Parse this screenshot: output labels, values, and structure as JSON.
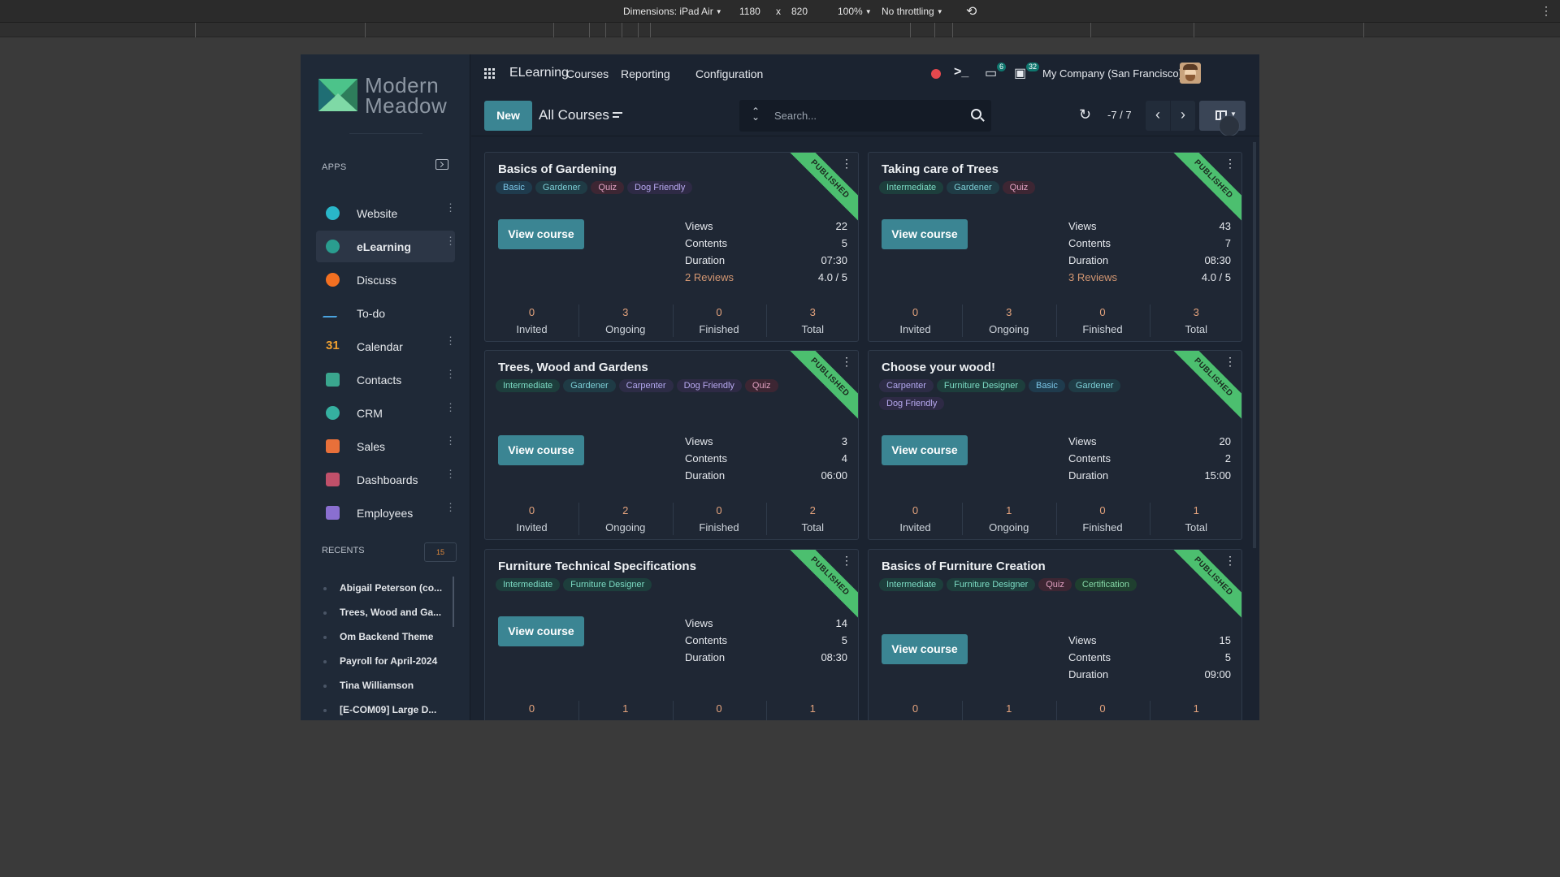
{
  "devtools": {
    "dimensions_label": "Dimensions: iPad Air",
    "width": "1180",
    "times": "x",
    "height": "820",
    "zoom": "100%",
    "throttling": "No throttling",
    "rotate_icon": "rotate-icon",
    "more_icon": "more-vertical-icon"
  },
  "sidebar": {
    "logo_line1": "Modern",
    "logo_line2": "Meadow",
    "apps_heading": "APPS",
    "apps": [
      {
        "label": "Website",
        "color": "#29b6c9",
        "menu": true
      },
      {
        "label": "eLearning",
        "color": "#2a9d8f",
        "menu": true,
        "active": true
      },
      {
        "label": "Discuss",
        "color": "#f37021",
        "menu": false
      },
      {
        "label": "To-do",
        "color": "#4aa3df",
        "menu": false
      },
      {
        "label": "Calendar",
        "color": "#f0a030",
        "menu": true
      },
      {
        "label": "Contacts",
        "color": "#3aa68e",
        "menu": true
      },
      {
        "label": "CRM",
        "color": "#35b0a0",
        "menu": true
      },
      {
        "label": "Sales",
        "color": "#e8703a",
        "menu": true
      },
      {
        "label": "Dashboards",
        "color": "#c0506a",
        "menu": true
      },
      {
        "label": "Employees",
        "color": "#8a6fd0",
        "menu": true
      }
    ],
    "calendar_glyph": "31",
    "recents_heading": "RECENTS",
    "recents_count": "15",
    "recents": [
      "Abigail Peterson (co...",
      "Trees, Wood and Ga...",
      "Om Backend Theme",
      "Payroll for April-2024",
      "Tina Williamson",
      "[E-COM09] Large D..."
    ]
  },
  "topnav": {
    "brand": "ELearning",
    "links": [
      "Courses",
      "Reporting",
      "Configuration"
    ],
    "messages_badge": "6",
    "activities_badge": "32",
    "company": "My Company (San Francisco)"
  },
  "control": {
    "new_label": "New",
    "breadcrumb": "All Courses",
    "search_placeholder": "Search...",
    "pager": "-7 / 7"
  },
  "tag_colors": {
    "Basic": {
      "bg": "#1f3b4d",
      "fg": "#7cc7e8"
    },
    "Gardener": {
      "bg": "#1f3b45",
      "fg": "#7ccfd6"
    },
    "Quiz": {
      "bg": "#3d2633",
      "fg": "#e0a0c0"
    },
    "Dog Friendly": {
      "bg": "#2e2a45",
      "fg": "#b8a9f0"
    },
    "Intermediate": {
      "bg": "#1d3e3c",
      "fg": "#7cdcc4"
    },
    "Carpenter": {
      "bg": "#2d2c46",
      "fg": "#b3a8f0"
    },
    "Furniture Designer": {
      "bg": "#1d3e3c",
      "fg": "#7cdcc4"
    },
    "Certification": {
      "bg": "#1f3f2f",
      "fg": "#86d9a8"
    }
  },
  "ribbon_label": "PUBLISHED",
  "view_course_label": "View course",
  "stat_labels": {
    "views": "Views",
    "contents": "Contents",
    "duration": "Duration"
  },
  "footer_labels": [
    "Invited",
    "Ongoing",
    "Finished",
    "Total"
  ],
  "courses": [
    {
      "title": "Basics of Gardening",
      "tags": [
        "Basic",
        "Gardener",
        "Quiz",
        "Dog Friendly"
      ],
      "views": "22",
      "contents": "5",
      "duration": "07:30",
      "reviews": "2 Reviews",
      "rating": "4.0 / 5",
      "counts": [
        "0",
        "3",
        "0",
        "3"
      ]
    },
    {
      "title": "Taking care of Trees",
      "tags": [
        "Intermediate",
        "Gardener",
        "Quiz"
      ],
      "views": "43",
      "contents": "7",
      "duration": "08:30",
      "reviews": "3 Reviews",
      "rating": "4.0 / 5",
      "counts": [
        "0",
        "3",
        "0",
        "3"
      ]
    },
    {
      "title": "Trees, Wood and Gardens",
      "tags": [
        "Intermediate",
        "Gardener",
        "Carpenter",
        "Dog Friendly",
        "Quiz"
      ],
      "views": "3",
      "contents": "4",
      "duration": "06:00",
      "counts": [
        "0",
        "2",
        "0",
        "2"
      ]
    },
    {
      "title": "Choose your wood!",
      "tags": [
        "Carpenter",
        "Furniture Designer",
        "Basic",
        "Gardener",
        "Dog Friendly"
      ],
      "views": "20",
      "contents": "2",
      "duration": "15:00",
      "counts": [
        "0",
        "1",
        "0",
        "1"
      ]
    },
    {
      "title": "Furniture Technical Specifications",
      "tags": [
        "Intermediate",
        "Furniture Designer"
      ],
      "views": "14",
      "contents": "5",
      "duration": "08:30",
      "counts": [
        "0",
        "1",
        "0",
        "1"
      ]
    },
    {
      "title": "Basics of Furniture Creation",
      "tags": [
        "Intermediate",
        "Furniture Designer",
        "Quiz",
        "Certification"
      ],
      "views": "15",
      "contents": "5",
      "duration": "09:00",
      "counts": [
        "0",
        "1",
        "0",
        "1"
      ]
    }
  ]
}
